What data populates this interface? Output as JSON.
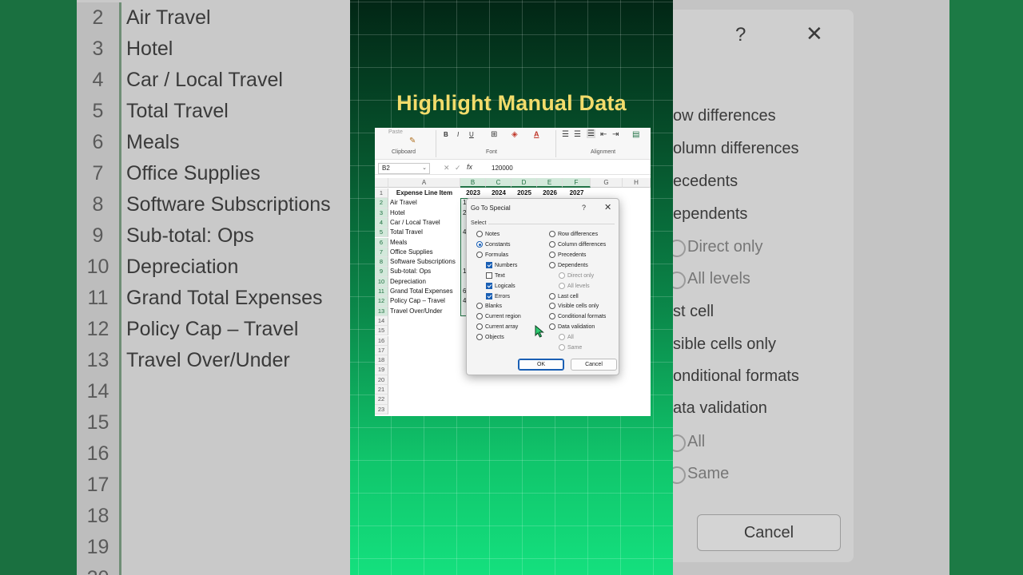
{
  "headline": "Highlight Manual Data",
  "colors": {
    "accent_green": "#217346",
    "headline_yellow": "#f3dc6b",
    "dialog_blue": "#1a5fb4"
  },
  "left_bg": {
    "rows": [
      {
        "n": "2",
        "label": "Air Travel"
      },
      {
        "n": "3",
        "label": "Hotel"
      },
      {
        "n": "4",
        "label": "Car / Local Travel"
      },
      {
        "n": "5",
        "label": "Total Travel"
      },
      {
        "n": "6",
        "label": "Meals"
      },
      {
        "n": "7",
        "label": "Office Supplies"
      },
      {
        "n": "8",
        "label": "Software Subscriptions"
      },
      {
        "n": "9",
        "label": "Sub-total: Ops"
      },
      {
        "n": "10",
        "label": "Depreciation"
      },
      {
        "n": "11",
        "label": "Grand Total Expenses"
      },
      {
        "n": "12",
        "label": "Policy Cap – Travel"
      },
      {
        "n": "13",
        "label": "Travel Over/Under"
      },
      {
        "n": "14",
        "label": ""
      },
      {
        "n": "15",
        "label": ""
      },
      {
        "n": "16",
        "label": ""
      },
      {
        "n": "17",
        "label": ""
      },
      {
        "n": "18",
        "label": ""
      },
      {
        "n": "19",
        "label": ""
      },
      {
        "n": "20",
        "label": ""
      }
    ]
  },
  "right_bg": {
    "help": "?",
    "close": "✕",
    "options": [
      "ow differences",
      "olumn differences",
      "ecedents",
      "ependents",
      "Direct only",
      "All levels",
      "st cell",
      "sible cells only",
      "onditional formats",
      "ata validation",
      "All",
      "Same"
    ],
    "cancel": "Cancel"
  },
  "ribbon": {
    "paste": "Paste",
    "clipboard": "Clipboard",
    "font": "Font",
    "alignment": "Alignment",
    "bold": "B",
    "italic": "I",
    "underline": "U"
  },
  "formula_bar": {
    "name_box": "B2",
    "fx": "fx",
    "value": "120000"
  },
  "columns": [
    "A",
    "B",
    "C",
    "D",
    "E",
    "F",
    "G",
    "H"
  ],
  "sheet": {
    "header_label": "Expense Line Item",
    "years": [
      "2023",
      "2024",
      "2025",
      "2026",
      "2027"
    ],
    "items": [
      "Air Travel",
      "Hotel",
      "Car / Local Travel",
      "Total Travel",
      "Meals",
      "Office Supplies",
      "Software Subscriptions",
      "Sub-total: Ops",
      "Depreciation",
      "Grand Total Expenses",
      "Policy Cap – Travel",
      "Travel Over/Under"
    ],
    "row_numbers": [
      "1",
      "2",
      "3",
      "4",
      "5",
      "6",
      "7",
      "8",
      "9",
      "10",
      "11",
      "12",
      "13",
      "14",
      "15",
      "16",
      "17",
      "18",
      "19",
      "20",
      "21",
      "22",
      "23"
    ],
    "b_fragments": [
      "1",
      "2",
      "",
      "4",
      "",
      "",
      "",
      "1",
      "",
      "6",
      "4"
    ]
  },
  "dialog": {
    "title": "Go To Special",
    "help": "?",
    "close": "✕",
    "select_label": "Select",
    "left_options": [
      "Notes",
      "Constants",
      "Formulas",
      "Numbers",
      "Text",
      "Logicals",
      "Errors",
      "Blanks",
      "Current region",
      "Current array",
      "Objects"
    ],
    "right_options": [
      "Row differences",
      "Column differences",
      "Precedents",
      "Dependents",
      "Direct only",
      "All levels",
      "Last cell",
      "Visible cells only",
      "Conditional formats",
      "Data validation",
      "All",
      "Same"
    ],
    "ok": "OK",
    "cancel": "Cancel"
  }
}
